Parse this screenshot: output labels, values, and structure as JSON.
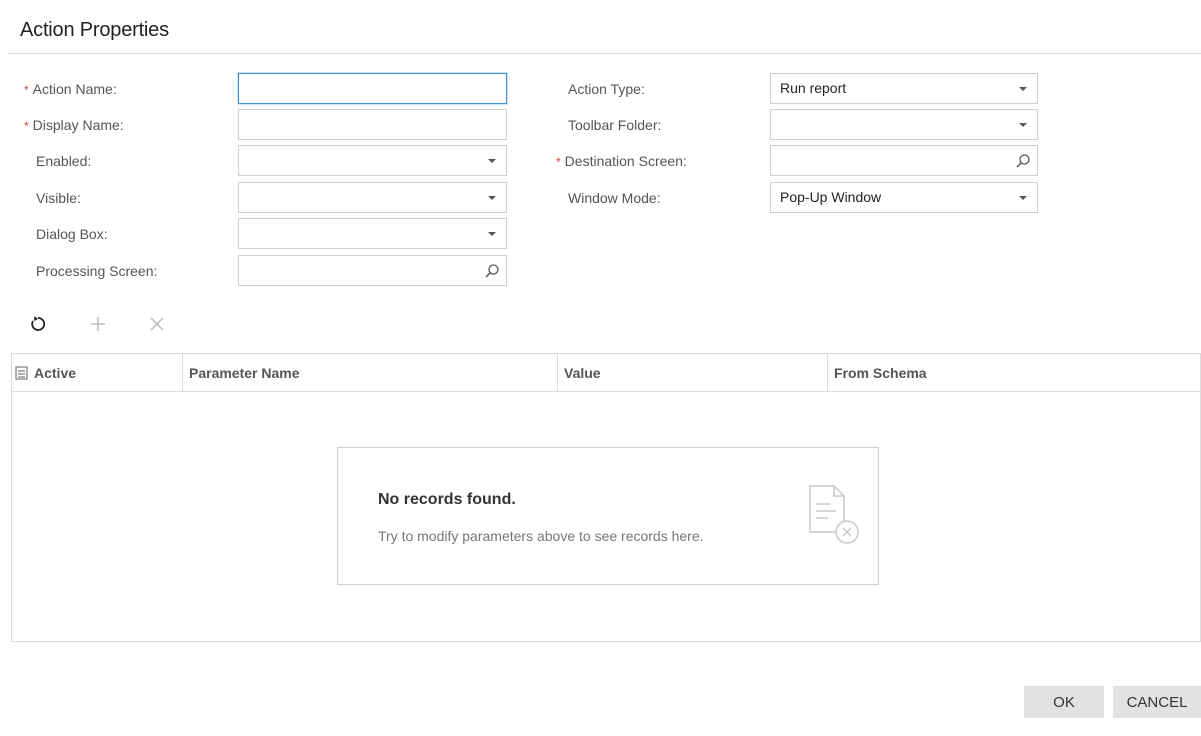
{
  "dialog": {
    "title": "Action Properties"
  },
  "left_form": {
    "action_name": {
      "label": "Action Name:",
      "required": true,
      "value": ""
    },
    "display_name": {
      "label": "Display Name:",
      "required": true,
      "value": ""
    },
    "enabled": {
      "label": "Enabled:",
      "value": ""
    },
    "visible": {
      "label": "Visible:",
      "value": ""
    },
    "dialog_box": {
      "label": "Dialog Box:",
      "value": ""
    },
    "processing_screen": {
      "label": "Processing Screen:",
      "value": ""
    }
  },
  "right_form": {
    "action_type": {
      "label": "Action Type:",
      "value": "Run report"
    },
    "toolbar_folder": {
      "label": "Toolbar Folder:",
      "value": ""
    },
    "destination_screen": {
      "label": "Destination Screen:",
      "required": true,
      "value": ""
    },
    "window_mode": {
      "label": "Window Mode:",
      "value": "Pop-Up Window"
    }
  },
  "grid_toolbar": {
    "refresh_icon": "refresh-icon",
    "add_icon": "plus-icon",
    "delete_icon": "close-icon"
  },
  "grid": {
    "columns": [
      "Active",
      "Parameter Name",
      "Value",
      "From Schema"
    ],
    "rows": [],
    "empty": {
      "title": "No records found.",
      "subtitle": "Try to modify parameters above to see records here."
    }
  },
  "footer": {
    "ok_label": "OK",
    "cancel_label": "CANCEL"
  },
  "colors": {
    "required": "#d04040",
    "focus": "#3b8fd9",
    "button_bg": "#e2e2e2"
  }
}
